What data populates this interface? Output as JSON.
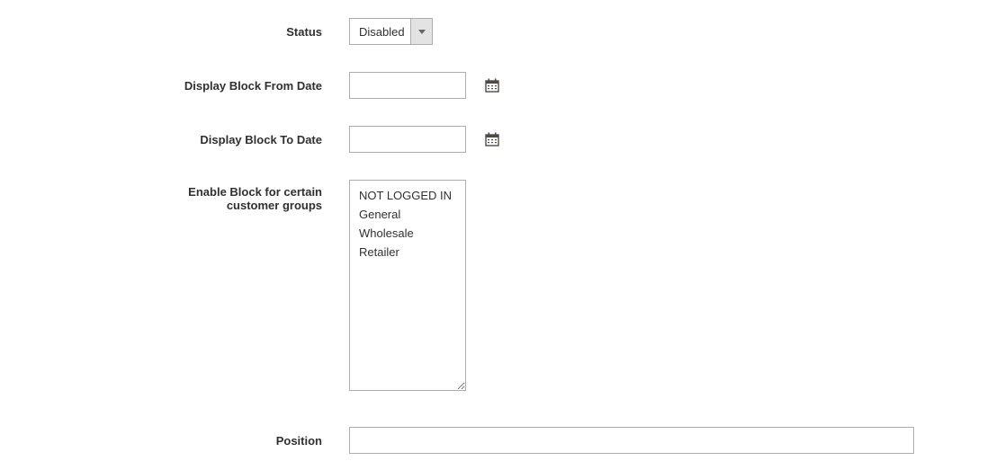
{
  "fields": {
    "status": {
      "label": "Status",
      "value": "Disabled"
    },
    "from_date": {
      "label": "Display Block From Date",
      "value": ""
    },
    "to_date": {
      "label": "Display Block To Date",
      "value": ""
    },
    "customer_groups": {
      "label": "Enable Block for certain customer groups",
      "options": [
        "NOT LOGGED IN",
        "General",
        "Wholesale",
        "Retailer"
      ]
    },
    "position": {
      "label": "Position",
      "value": ""
    }
  }
}
